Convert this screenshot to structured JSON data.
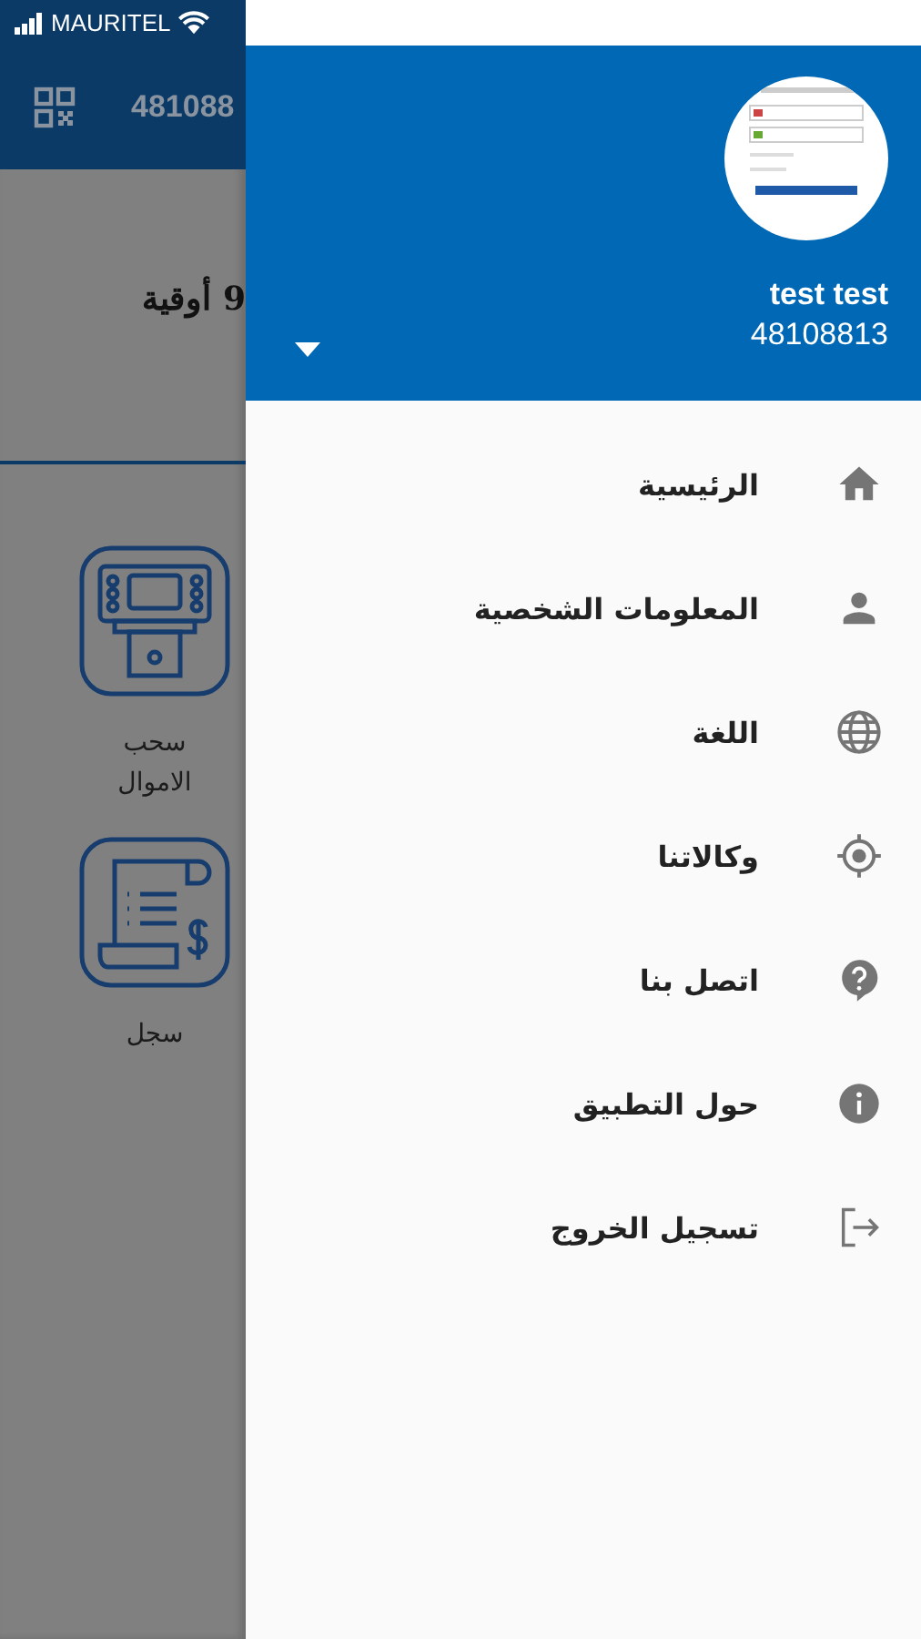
{
  "status_bar": {
    "carrier": "MAURITEL"
  },
  "background_screen": {
    "app_bar": {
      "account_number": "481088"
    },
    "balance": "9 أوقية",
    "services": [
      {
        "kind": "atm",
        "label": "سحب الاموال"
      },
      {
        "kind": "ledger",
        "label": "سجل"
      }
    ]
  },
  "drawer": {
    "user": {
      "name": "test test",
      "phone": "48108813"
    },
    "items": [
      {
        "kind": "home",
        "label": "الرئيسية"
      },
      {
        "kind": "person",
        "label": "المعلومات الشخصية"
      },
      {
        "kind": "globe",
        "label": "اللغة"
      },
      {
        "kind": "target",
        "label": "وكالاتنا"
      },
      {
        "kind": "help",
        "label": "اتصل بنا"
      },
      {
        "kind": "info",
        "label": "حول التطبيق"
      },
      {
        "kind": "logout",
        "label": "تسجيل الخروج"
      }
    ]
  }
}
